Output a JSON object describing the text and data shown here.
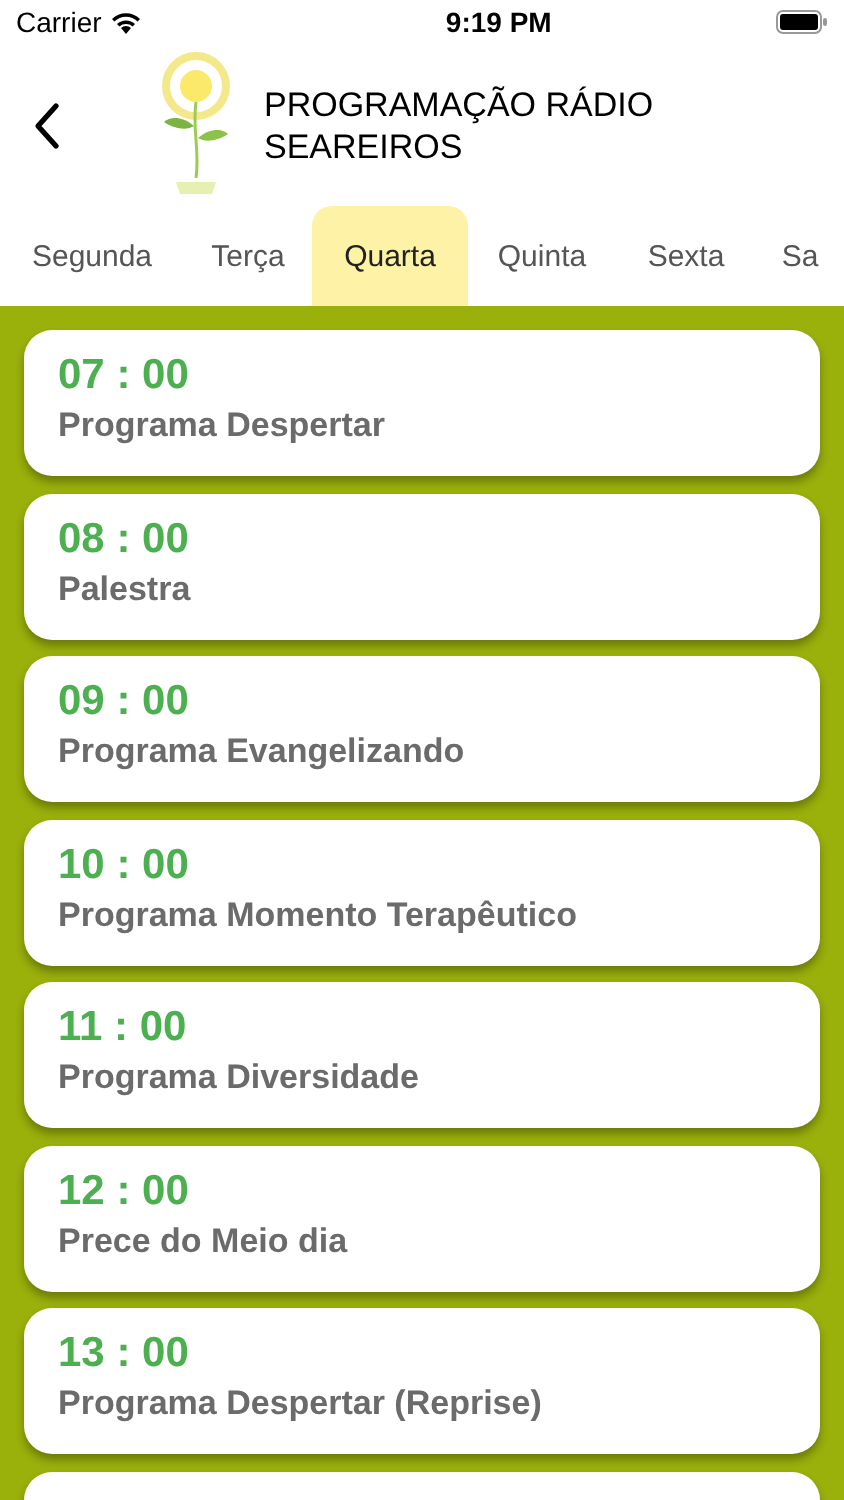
{
  "status_bar": {
    "carrier": "Carrier",
    "time": "9:19 PM"
  },
  "header": {
    "title": "PROGRAMAÇÃO RÁDIO SEAREIROS"
  },
  "tabs": [
    {
      "label": "Segunda",
      "selected": false
    },
    {
      "label": "Terça",
      "selected": false
    },
    {
      "label": "Quarta",
      "selected": true
    },
    {
      "label": "Quinta",
      "selected": false
    },
    {
      "label": "Sexta",
      "selected": false
    },
    {
      "label": "Sa",
      "selected": false
    }
  ],
  "programs": [
    {
      "time": "07 : 00",
      "name": "Programa Despertar"
    },
    {
      "time": "08 : 00",
      "name": "Palestra"
    },
    {
      "time": "09 : 00",
      "name": "Programa Evangelizando"
    },
    {
      "time": "10 : 00",
      "name": "Programa Momento Terapêutico"
    },
    {
      "time": "11 : 00",
      "name": "Programa Diversidade"
    },
    {
      "time": "12 : 00",
      "name": "Prece do Meio dia"
    },
    {
      "time": "13 : 00",
      "name": "Programa Despertar (Reprise)"
    }
  ]
}
